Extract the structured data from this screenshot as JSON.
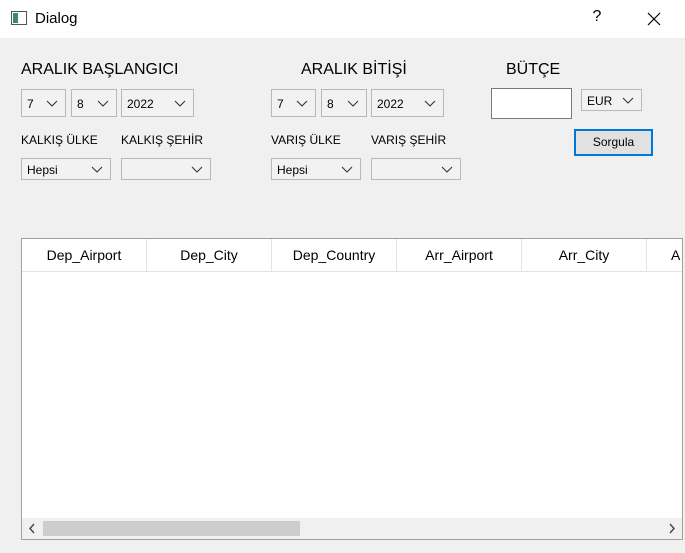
{
  "window": {
    "title": "Dialog",
    "help_label": "?"
  },
  "range_start": {
    "heading": "ARALIK BAŞLANGICI",
    "month": "7",
    "day": "8",
    "year": "2022"
  },
  "range_end": {
    "heading": "ARALIK BİTİŞİ",
    "month": "7",
    "day": "8",
    "year": "2022"
  },
  "budget": {
    "heading": "BÜTÇE",
    "value": "",
    "currency": "EUR"
  },
  "departure": {
    "country_label": "KALKIŞ ÜLKE",
    "country_value": "Hepsi",
    "city_label": "KALKIŞ ŞEHİR",
    "city_value": ""
  },
  "arrival": {
    "country_label": "VARIŞ ÜLKE",
    "country_value": "Hepsi",
    "city_label": "VARIŞ ŞEHİR",
    "city_value": ""
  },
  "query_button": "Sorgula",
  "table": {
    "columns": [
      "Dep_Airport",
      "Dep_City",
      "Dep_Country",
      "Arr_Airport",
      "Arr_City",
      "A"
    ],
    "rows": []
  },
  "icons": {
    "app": "window-app-icon",
    "close": "close-icon",
    "dropdown": "chevron-down-icon",
    "scroll_left": "arrow-left-icon",
    "scroll_right": "arrow-right-icon"
  },
  "colors": {
    "focus_accent": "#0078d7",
    "window_bg": "#f0f0f0"
  }
}
